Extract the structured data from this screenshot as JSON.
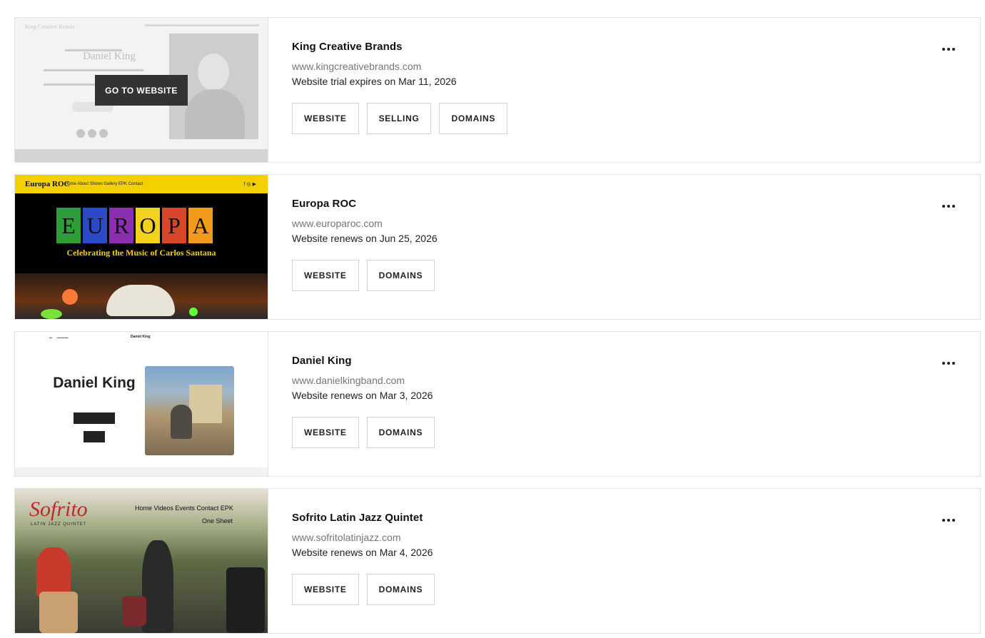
{
  "sites": [
    {
      "title": "King Creative Brands",
      "domain": "www.kingcreativebrands.com",
      "status": "Website trial expires on Mar 11, 2026",
      "buttons": [
        "WEBSITE",
        "SELLING",
        "DOMAINS"
      ],
      "thumb": {
        "overlay_label": "GO TO WEBSITE",
        "header": "King Creative Brands",
        "hero_name": "Daniel King"
      }
    },
    {
      "title": "Europa ROC",
      "domain": "www.europaroc.com",
      "status": "Website renews on Jun 25, 2026",
      "buttons": [
        "WEBSITE",
        "DOMAINS"
      ],
      "thumb": {
        "brand": "Europa ROC",
        "nav": "Home  About  Shows  Gallery  EPK  Contact",
        "letters": [
          "E",
          "U",
          "R",
          "O",
          "P",
          "A"
        ],
        "letter_colors": [
          "#2e9e3a",
          "#2c49c7",
          "#8a2fb0",
          "#f2d21c",
          "#d9472b",
          "#f29a1c"
        ],
        "tagline": "Celebrating the Music of Carlos Santana"
      }
    },
    {
      "title": "Daniel King",
      "domain": "www.danielkingband.com",
      "status": "Website renews on Mar 3, 2026",
      "buttons": [
        "WEBSITE",
        "DOMAINS"
      ],
      "thumb": {
        "brand": "Daniel King",
        "hero_name": "Daniel King"
      }
    },
    {
      "title": "Sofrito Latin Jazz Quintet",
      "domain": "www.sofritolatinjazz.com",
      "status": "Website renews on Mar 4, 2026",
      "buttons": [
        "WEBSITE",
        "DOMAINS"
      ],
      "thumb": {
        "logo": "Sofrito",
        "logo_sub": "LATIN JAZZ QUINTET",
        "nav": "Home  Videos  Events  Contact  EPK",
        "nav2": "One Sheet"
      }
    }
  ],
  "more_icon": "ellipsis-icon"
}
